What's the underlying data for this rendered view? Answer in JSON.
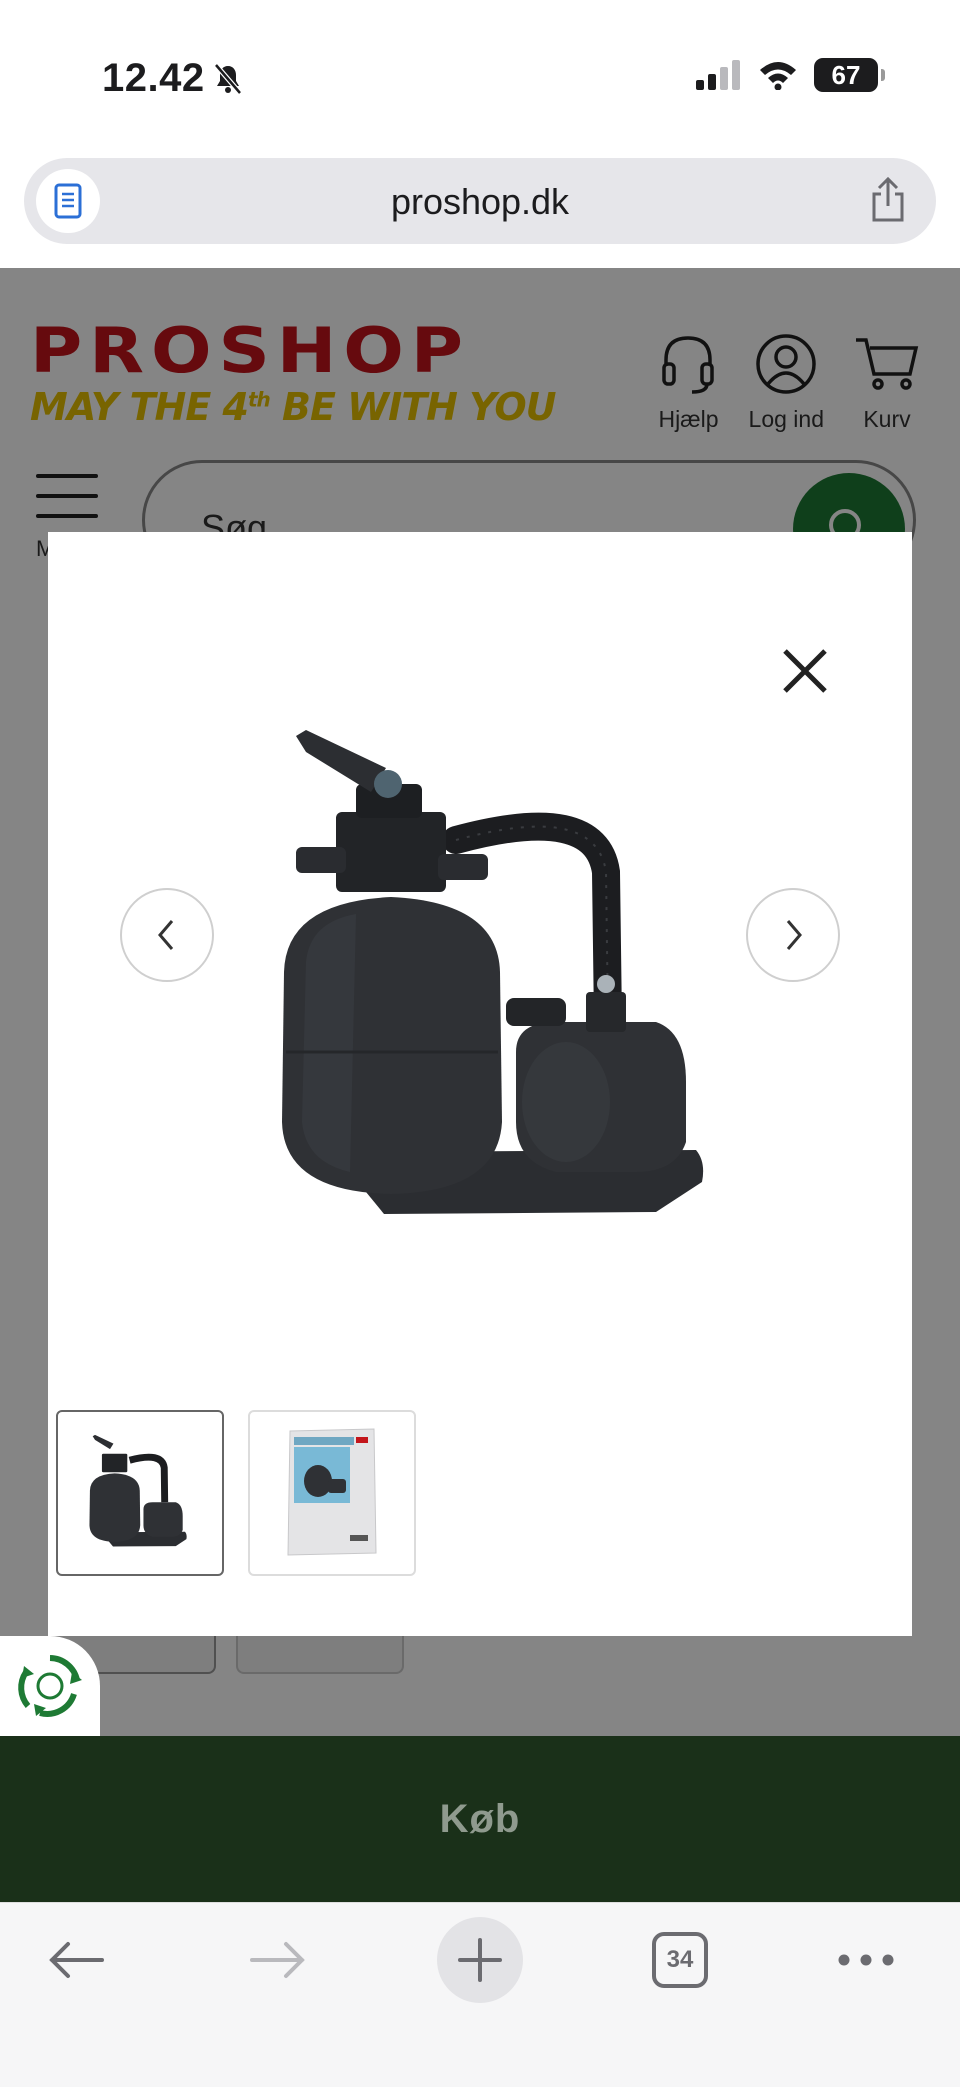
{
  "status_bar": {
    "time": "12.42",
    "battery": "67"
  },
  "browser": {
    "url": "proshop.dk",
    "tab_count": "34"
  },
  "site_header": {
    "logo_text": "PROSHOP",
    "tagline_pre": "MAY THE 4",
    "tagline_sup": "th",
    "tagline_post": " BE WITH YOU",
    "actions": [
      {
        "label": "Hjælp",
        "icon": "headset-icon"
      },
      {
        "label": "Log ind",
        "icon": "user-icon"
      },
      {
        "label": "Kurv",
        "icon": "cart-icon"
      }
    ],
    "menu_label": "M",
    "search_placeholder": "Søg"
  },
  "gallery_modal": {
    "image_count": 2,
    "active_index": 0,
    "icons": {
      "close": "close-icon",
      "prev": "chevron-left-icon",
      "next": "chevron-right-icon"
    }
  },
  "buy_bar": {
    "label": "Køb"
  },
  "colors": {
    "brand_red": "#c3151b",
    "brand_yellow": "#e6c000",
    "buy_bar": "#1a3019",
    "search_button": "#1e7a34"
  }
}
